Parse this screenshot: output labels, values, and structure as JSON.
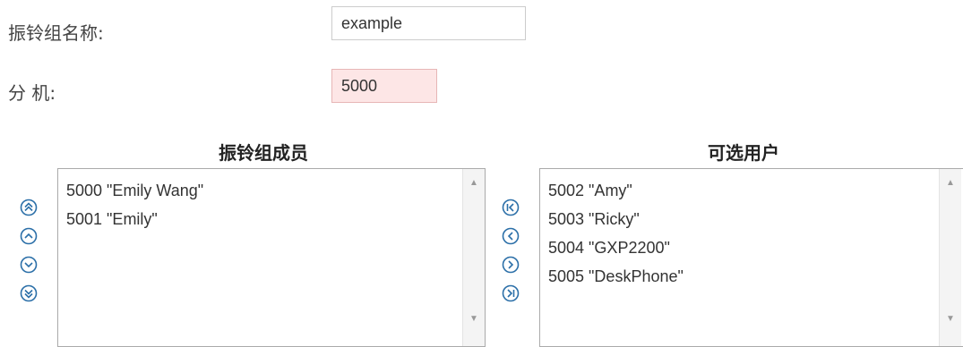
{
  "form": {
    "group_name_label": "振铃组名称:",
    "group_name_value": "example",
    "extension_label": "分 机:",
    "extension_value": "5000"
  },
  "members": {
    "title": "振铃组成员",
    "items": [
      "5000 \"Emily Wang\"",
      "5001 \"Emily\""
    ]
  },
  "available": {
    "title": "可选用户",
    "items": [
      "5002 \"Amy\"",
      "5003 \"Ricky\"",
      "5004 \"GXP2200\"",
      "5005 \"DeskPhone\""
    ]
  },
  "icons": {
    "member_controls": [
      "move-top-icon",
      "move-up-icon",
      "move-down-icon",
      "move-bottom-icon"
    ],
    "transfer_controls": [
      "move-all-left-icon",
      "move-left-icon",
      "move-right-icon",
      "move-all-right-icon"
    ],
    "color": "#2b6fa8"
  }
}
